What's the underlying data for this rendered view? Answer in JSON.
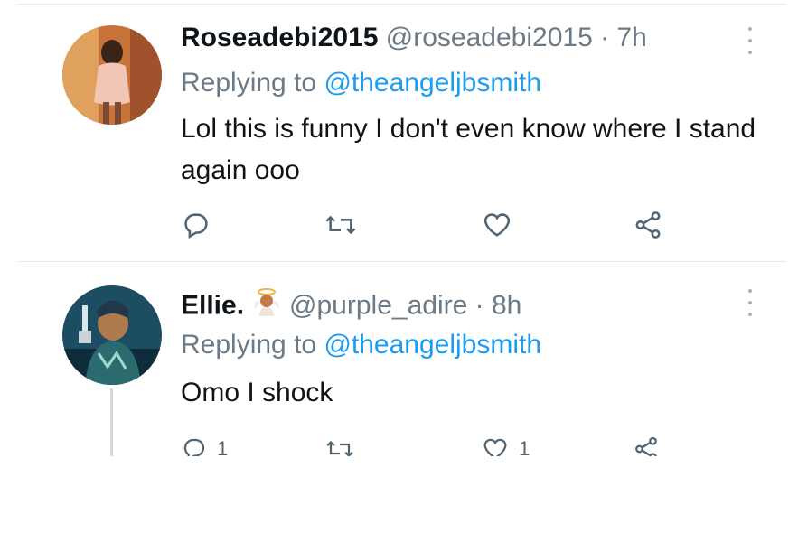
{
  "tweets": [
    {
      "display_name": "Roseadebi2015",
      "handle": "@roseadebi2015",
      "time": "· 7h",
      "replying_label": "Replying to",
      "replying_to": "@theangeljbsmith",
      "text": "Lol this is funny I don't even know where I stand again ooo",
      "actions": {
        "reply_count": "",
        "retweet_count": "",
        "like_count": ""
      }
    },
    {
      "display_name": "Ellie.",
      "handle": "@purple_adire",
      "time": "· 8h",
      "replying_label": "Replying to",
      "replying_to": "@theangeljbsmith",
      "text": "Omo I shock",
      "actions": {
        "reply_count": "1",
        "retweet_count": "",
        "like_count": "1"
      }
    }
  ],
  "colors": {
    "accent": "#1d9bf0",
    "muted": "#6b7a86",
    "divider": "#e6e9ec"
  }
}
